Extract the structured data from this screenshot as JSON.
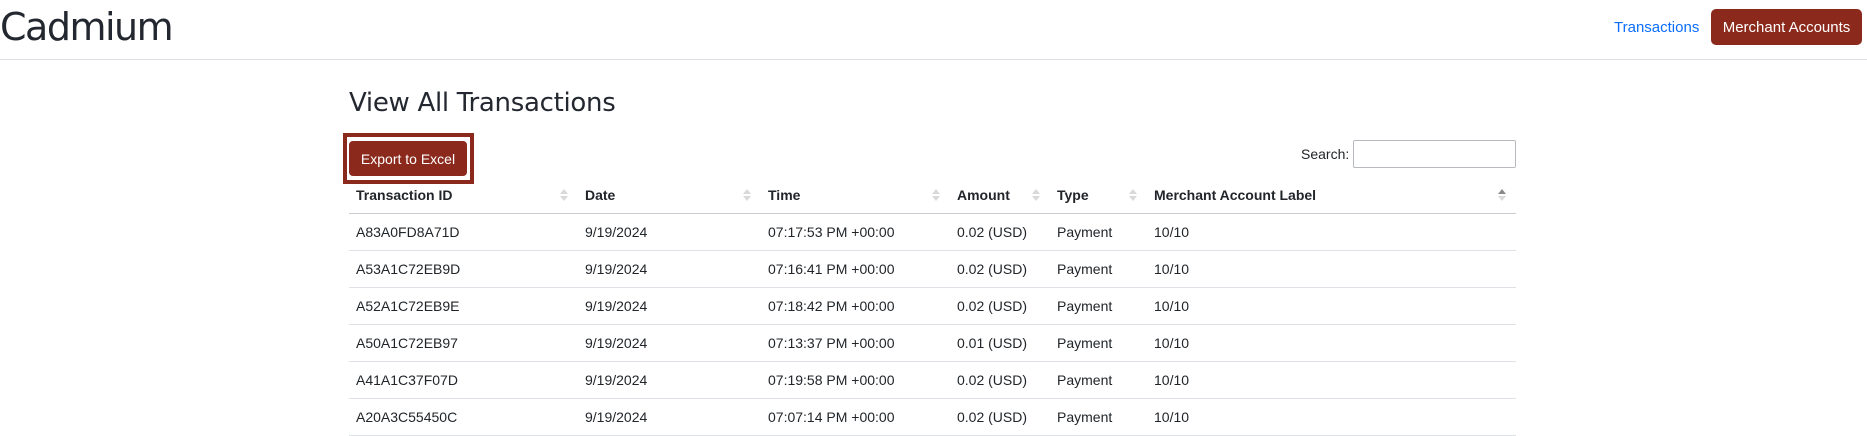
{
  "nav": {
    "brand": "Cadmium",
    "transactions_link": "Transactions",
    "merchant_accounts_button": "Merchant Accounts"
  },
  "page": {
    "title": "View All Transactions",
    "export_button": "Export to Excel",
    "search_label": "Search:",
    "search_value": ""
  },
  "colors": {
    "accent": "#8b2a1c",
    "link": "#0d6efd"
  },
  "table": {
    "columns": [
      "Transaction ID",
      "Date",
      "Time",
      "Amount",
      "Type",
      "Merchant Account Label"
    ],
    "sorted_column": "Merchant Account Label",
    "sort_direction": "ascending",
    "rows": [
      [
        "A83A0FD8A71D",
        "9/19/2024",
        "07:17:53 PM +00:00",
        "0.02 (USD)",
        "Payment",
        "10/10"
      ],
      [
        "A53A1C72EB9D",
        "9/19/2024",
        "07:16:41 PM +00:00",
        "0.02 (USD)",
        "Payment",
        "10/10"
      ],
      [
        "A52A1C72EB9E",
        "9/19/2024",
        "07:18:42 PM +00:00",
        "0.02 (USD)",
        "Payment",
        "10/10"
      ],
      [
        "A50A1C72EB97",
        "9/19/2024",
        "07:13:37 PM +00:00",
        "0.01 (USD)",
        "Payment",
        "10/10"
      ],
      [
        "A41A1C37F07D",
        "9/19/2024",
        "07:19:58 PM +00:00",
        "0.02 (USD)",
        "Payment",
        "10/10"
      ],
      [
        "A20A3C55450C",
        "9/19/2024",
        "07:07:14 PM +00:00",
        "0.02 (USD)",
        "Payment",
        "10/10"
      ]
    ]
  }
}
